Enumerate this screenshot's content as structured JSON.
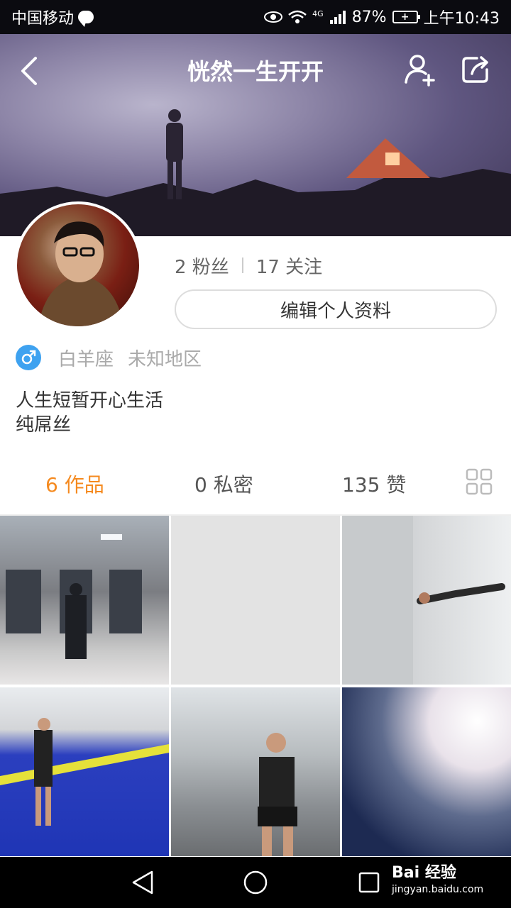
{
  "status_bar": {
    "carrier": "中国移动",
    "network": "4G",
    "battery": "87%",
    "time": "上午10:43"
  },
  "header": {
    "title": "恍然一生开开"
  },
  "profile": {
    "followers": "2 粉丝",
    "following": "17 关注",
    "edit_label": "编辑个人资料",
    "zodiac": "白羊座",
    "region": "未知地区",
    "bio_line1": "人生短暂开心生活",
    "bio_line2": "纯屌丝"
  },
  "tabs": {
    "works": "6 作品",
    "private": "0 私密",
    "likes": "135 赞"
  },
  "watermark": {
    "brand": "Bai 经验",
    "url": "jingyan.baidu.com"
  },
  "colors": {
    "accent": "#f58a1f",
    "gender_badge": "#3ea2f0"
  }
}
